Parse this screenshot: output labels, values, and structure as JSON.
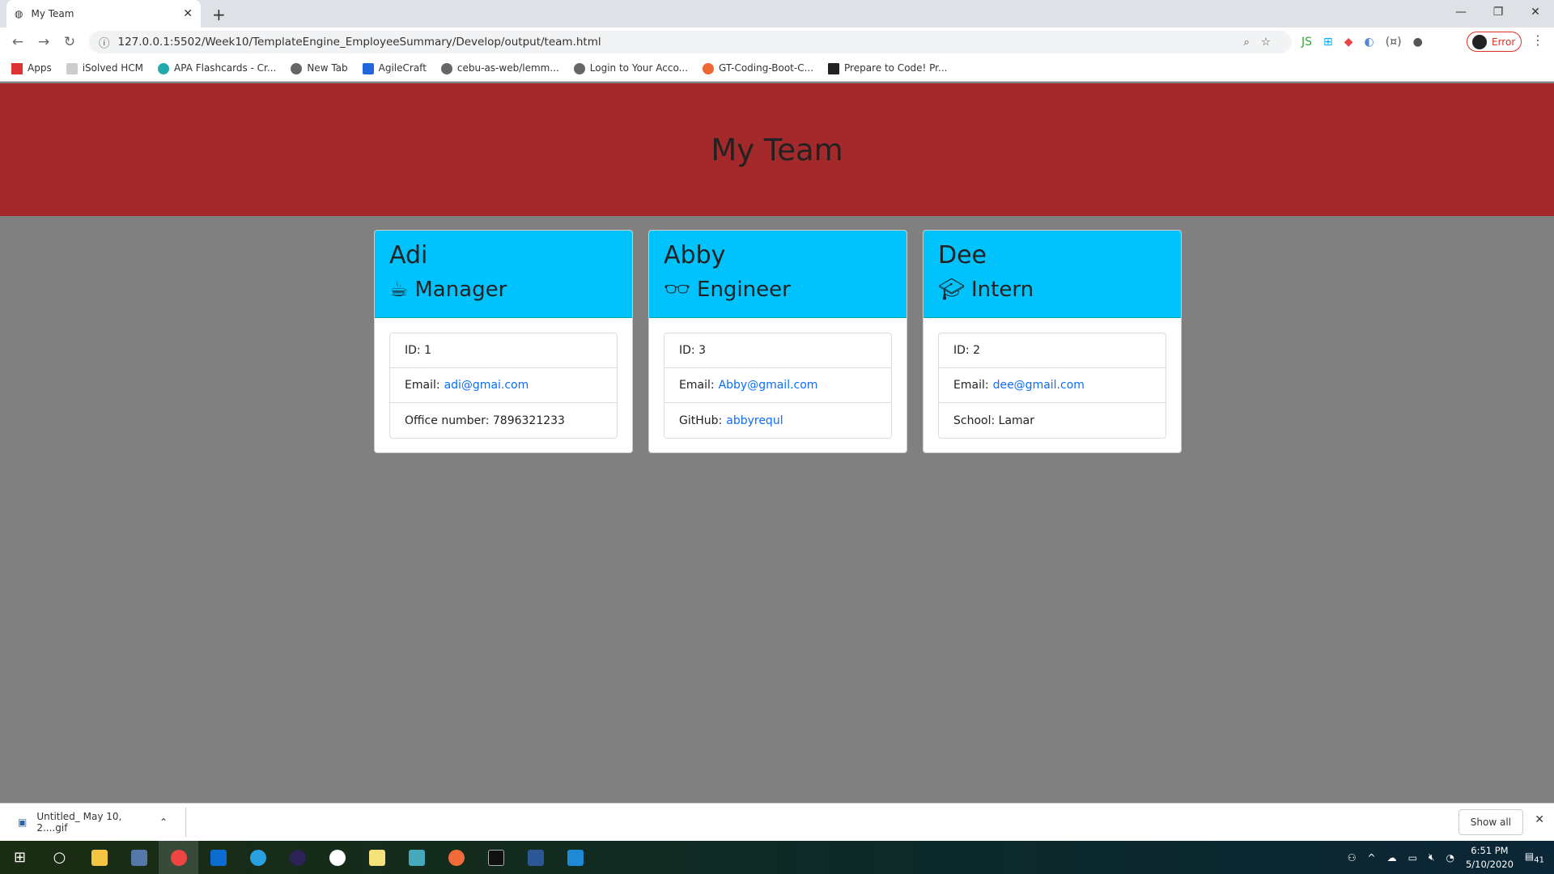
{
  "browser": {
    "tab_title": "My Team",
    "url": "127.0.0.1:5502/Week10/TemplateEngine_EmployeeSummary/Develop/output/team.html",
    "profile_status": "Error",
    "bookmarks": [
      "Apps",
      "iSolved HCM",
      "APA Flashcards - Cr...",
      "New Tab",
      "AgileCraft",
      "cebu-as-web/lemm...",
      "Login to Your Acco...",
      "GT-Coding-Boot-C...",
      "Prepare to Code! Pr..."
    ]
  },
  "page": {
    "title": "My Team",
    "header_color": "#a4292b",
    "card_header_color": "#00c3fe",
    "link_color": "#0b6efd",
    "cards": [
      {
        "name": "Adi",
        "role": "Manager",
        "icon": "coffee-mug-icon",
        "id_label": "ID: 1",
        "email_label": "Email:",
        "email": "adi@gmai.com",
        "extra_label": "Office number: 7896321233",
        "extra_link": ""
      },
      {
        "name": "Abby",
        "role": "Engineer",
        "icon": "glasses-icon",
        "id_label": "ID: 3",
        "email_label": "Email:",
        "email": "Abby@gmail.com",
        "extra_label": "GitHub:",
        "extra_link": "abbyrequl"
      },
      {
        "name": "Dee",
        "role": "Intern",
        "icon": "graduate-icon",
        "id_label": "ID: 2",
        "email_label": "Email:",
        "email": "dee@gmail.com",
        "extra_label": "School: Lamar",
        "extra_link": ""
      }
    ]
  },
  "downloads": {
    "file": "Untitled_ May 10, 2....gif",
    "show_all": "Show all"
  },
  "taskbar": {
    "time": "6:51 PM",
    "date": "5/10/2020",
    "notifications": "41"
  }
}
